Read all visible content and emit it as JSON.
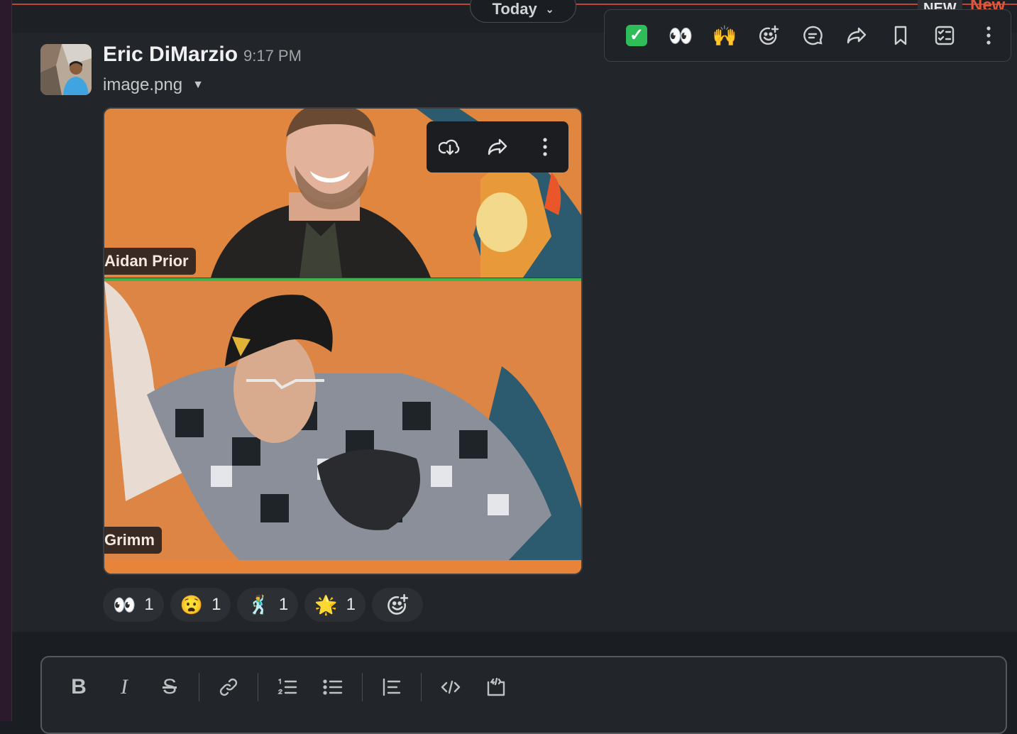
{
  "divider": {
    "label": "Today",
    "badge": "NEW",
    "new_label": "New"
  },
  "hover_toolbar": {
    "actions": [
      {
        "name": "check-reaction",
        "glyph": "✓"
      },
      {
        "name": "eyes-reaction",
        "glyph": "👀"
      },
      {
        "name": "raised-hands-reaction",
        "glyph": "🙌"
      }
    ]
  },
  "message": {
    "sender": "Eric DiMarzio",
    "time": "9:17 PM",
    "file_name": "image.png",
    "image": {
      "top_name": "Aidan Prior",
      "bottom_name": "Grimm"
    },
    "reactions": [
      {
        "emoji": "👀",
        "count": "1"
      },
      {
        "emoji": "😧",
        "count": "1"
      },
      {
        "emoji": "🕺",
        "count": "1"
      },
      {
        "emoji": "🌟",
        "count": "1"
      }
    ]
  },
  "composer": {
    "tools": [
      "bold",
      "italic",
      "strikethrough",
      "link",
      "ordered-list",
      "bulleted-list",
      "blockquote",
      "code",
      "code-block"
    ]
  },
  "colors": {
    "accent_new": "#e0573b",
    "divider_green": "#3fb34f",
    "background": "#1a1d21"
  }
}
